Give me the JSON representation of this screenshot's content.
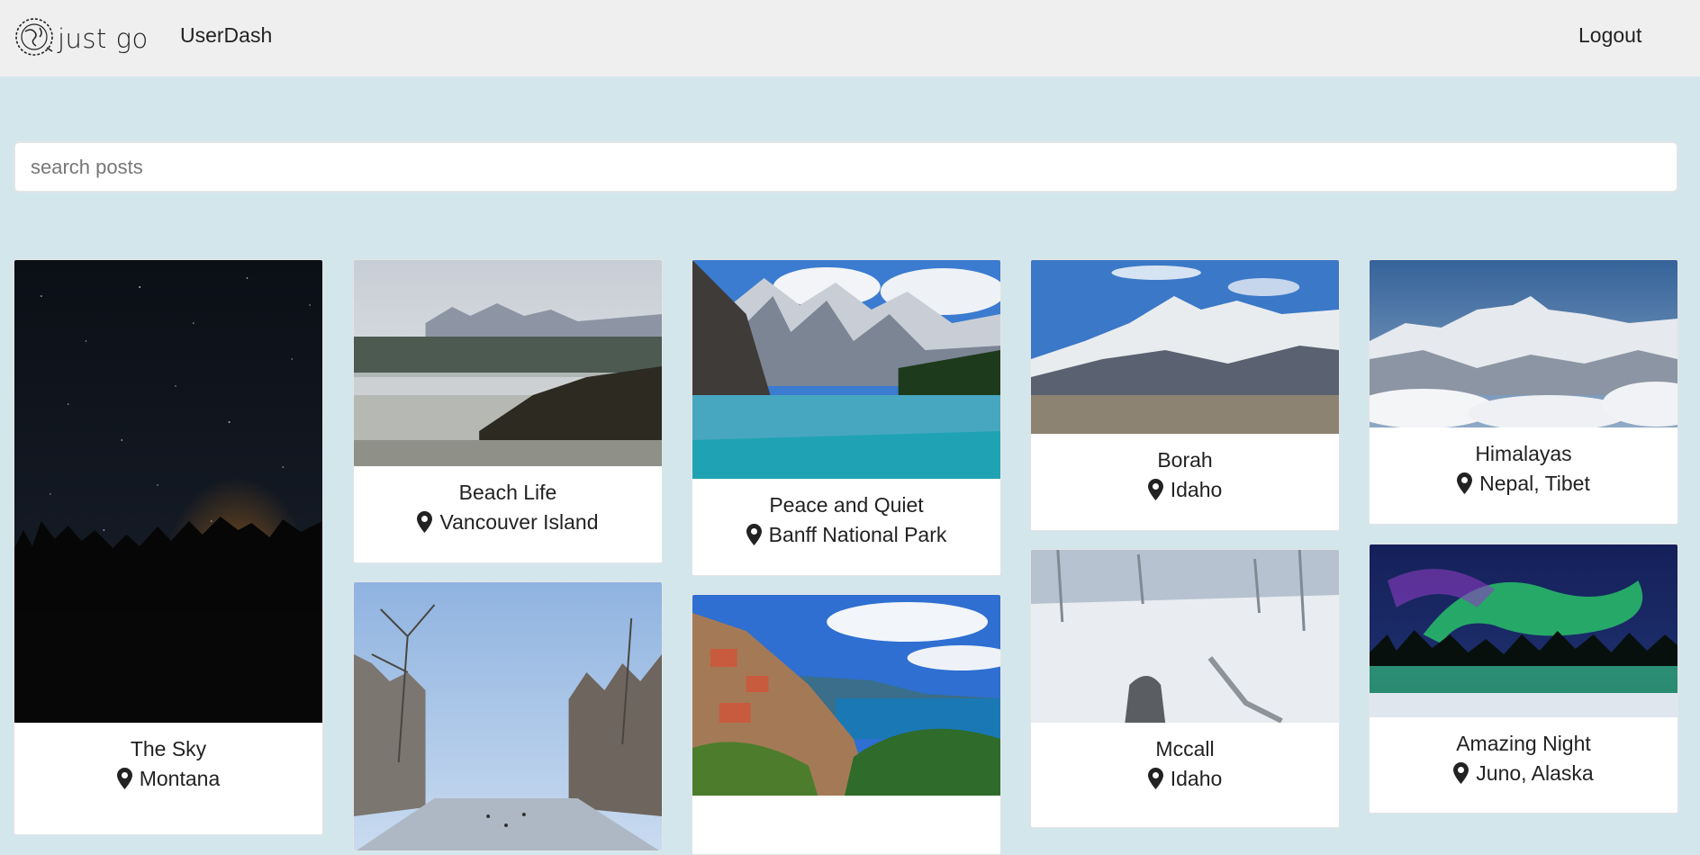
{
  "nav": {
    "brand": "just go",
    "dash_link": "UserDash",
    "logout": "Logout"
  },
  "search": {
    "placeholder": "search posts",
    "value": ""
  },
  "posts": [
    {
      "title": "The Sky",
      "location": "Montana",
      "image": "night sky over treeline"
    },
    {
      "title": "Beach Life",
      "location": "Vancouver Island",
      "image": "misty beach with mountains"
    },
    {
      "title": "Peace and Quiet",
      "location": "Banff National Park",
      "image": "turquoise mountain lake"
    },
    {
      "title": "Borah",
      "location": "Idaho",
      "image": "snowy peak"
    },
    {
      "title": "Himalayas",
      "location": "Nepal, Tibet",
      "image": "himalayan range above clouds"
    },
    {
      "title": "",
      "location": "",
      "image": "canal city in winter"
    },
    {
      "title": "",
      "location": "",
      "image": "cliffside coastal town"
    },
    {
      "title": "Mccall",
      "location": "Idaho",
      "image": "snowy ski slope"
    },
    {
      "title": "Amazing Night",
      "location": "Juno, Alaska",
      "image": "aurora over lake"
    }
  ],
  "icons": {
    "pin": "map-marker-icon",
    "logo": "globe-icon"
  }
}
